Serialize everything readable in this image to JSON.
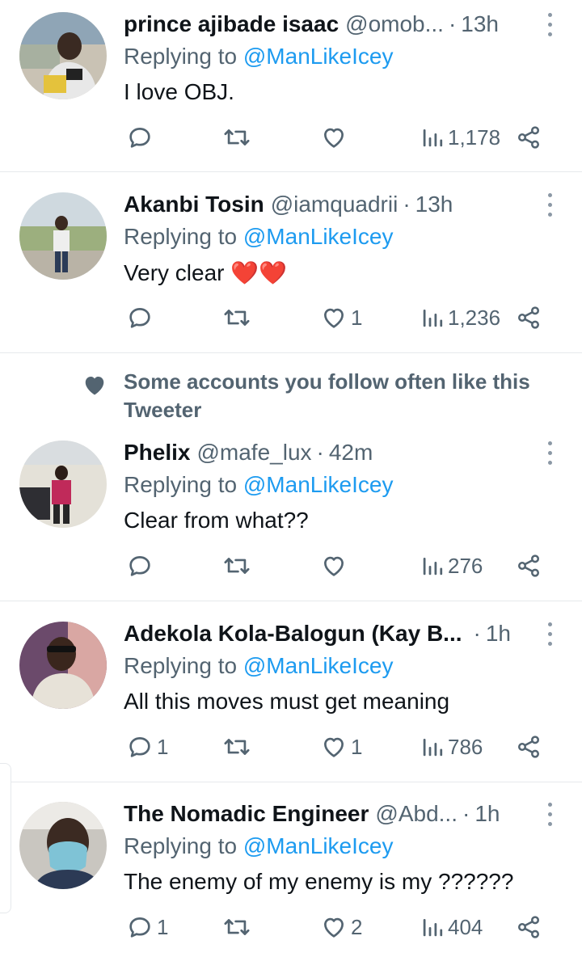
{
  "replying_prefix": "Replying to",
  "tweets": [
    {
      "name": "prince ajibade isaac",
      "handle": "@omob...",
      "dot": "·",
      "time": "13h",
      "mention": "@ManLikeIcey",
      "text": "I love OBJ.",
      "replies": "",
      "retweets": "",
      "likes": "",
      "views": "1,178",
      "avatar_icon": "person-photo"
    },
    {
      "name": "Akanbi Tosin",
      "handle": "@iamquadrii",
      "dot": "·",
      "time": "13h",
      "mention": "@ManLikeIcey",
      "text": "Very clear ❤️❤️",
      "replies": "",
      "retweets": "",
      "likes": "1",
      "views": "1,236",
      "avatar_icon": "person-photo"
    },
    {
      "name": "Phelix",
      "handle": "@mafe_lux",
      "dot": "·",
      "time": "42m",
      "mention": "@ManLikeIcey",
      "text": "Clear from what??",
      "replies": "",
      "retweets": "",
      "likes": "",
      "views": "276",
      "avatar_icon": "person-photo"
    },
    {
      "name": "Adekola Kola-Balogun (Kay B...",
      "handle": "",
      "dot": "·",
      "time": "1h",
      "mention": "@ManLikeIcey",
      "text": "All this moves must get meaning",
      "replies": "1",
      "retweets": "",
      "likes": "1",
      "views": "786",
      "avatar_icon": "person-photo"
    },
    {
      "name": "The Nomadic Engineer",
      "handle": "@Abd...",
      "dot": "·",
      "time": "1h",
      "mention": "@ManLikeIcey",
      "text": "The enemy of my enemy is my ??????",
      "replies": "1",
      "retweets": "",
      "likes": "2",
      "views": "404",
      "avatar_icon": "person-photo"
    }
  ],
  "social_context": {
    "text": "Some accounts you follow often like this Tweeter",
    "icon": "heart-icon"
  },
  "colors": {
    "text": "#0f1419",
    "secondary": "#536471",
    "mention": "#1d9bf0",
    "divider": "#e6e9ec"
  }
}
